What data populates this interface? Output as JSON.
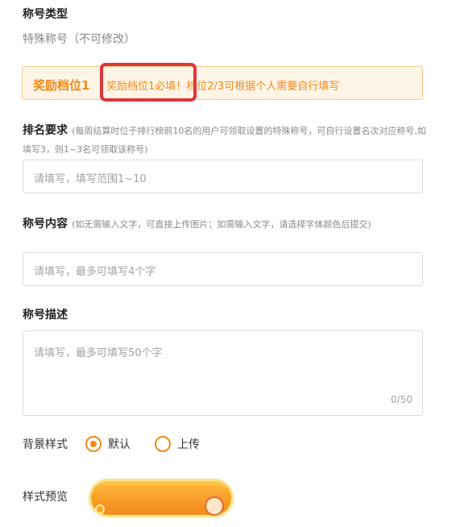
{
  "title_type": {
    "label": "称号类型",
    "value": "特殊称号（不可修改）"
  },
  "tier_bar": {
    "title": "奖励档位1",
    "note": "奖励档位1必填！档位2/3可根据个人需要自行填写"
  },
  "ranking": {
    "label": "排名要求",
    "hint": "(每周结算时位于排行榜前10名的用户可领取设置的特殊称号，可自行设置名次对应称号,如填写3，则1~3名可领取该称号)",
    "placeholder": "请填写，填写范围1~10"
  },
  "content": {
    "label": "称号内容",
    "hint": "(如无需输入文字，可直接上传图片；如需输入文字，请选择字体颜色后提交)",
    "placeholder": "请填写，最多可填写4个字"
  },
  "description": {
    "label": "称号描述",
    "placeholder": "请填写，最多可填写50个字",
    "counter": "0/50"
  },
  "background": {
    "label": "背景样式",
    "options": [
      {
        "label": "默认",
        "selected": true
      },
      {
        "label": "上传",
        "selected": false
      }
    ]
  },
  "preview": {
    "label": "样式预览"
  },
  "colors": {
    "accent": "#f08a1c",
    "highlight": "#e0353a"
  }
}
